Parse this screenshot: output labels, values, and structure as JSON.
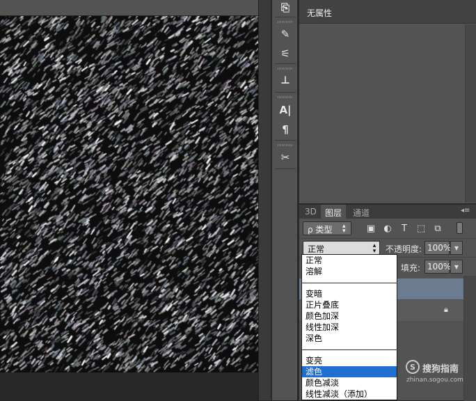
{
  "properties": {
    "title": "无属性"
  },
  "layers_panel": {
    "tabs": [
      {
        "label": "3D"
      },
      {
        "label": "图层"
      },
      {
        "label": "通道"
      }
    ],
    "filter": {
      "label": "类型",
      "icon": "ρ"
    },
    "blend_mode": "正常",
    "opacity_label": "不透明度:",
    "opacity_value": "100%",
    "fill_label": "填充:",
    "fill_value": "100%"
  },
  "blend_dropdown": {
    "items": [
      "正常",
      "溶解",
      "变暗",
      "正片叠底",
      "颜色加深",
      "线性加深",
      "深色",
      "变亮",
      "滤色",
      "颜色减淡",
      "线性减淡（添加）"
    ],
    "highlighted": "滤色"
  },
  "watermark": {
    "brand": "搜狗指南",
    "url": "zhinan.sogou.com",
    "logo_letter": "S"
  },
  "colors": {
    "accent": "#1e6fd0",
    "panel": "#535353",
    "selected_layer": "#6d7b91"
  }
}
